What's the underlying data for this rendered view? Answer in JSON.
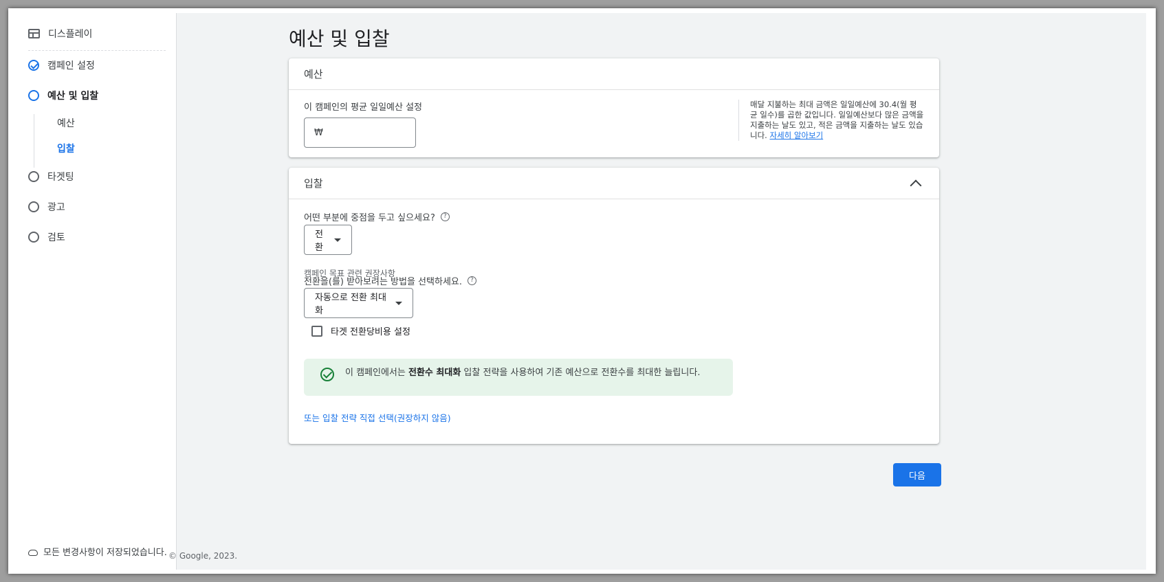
{
  "sidebar": {
    "items": [
      {
        "label": "디스플레이",
        "icon": "display-icon"
      },
      {
        "label": "캠페인 설정",
        "icon": "check-circle-icon"
      },
      {
        "label": "예산 및 입찰",
        "icon": "circle-icon"
      },
      {
        "label": "타겟팅",
        "icon": "circle-icon"
      },
      {
        "label": "광고",
        "icon": "circle-icon"
      },
      {
        "label": "검토",
        "icon": "circle-icon"
      }
    ],
    "sub_items": [
      {
        "label": "예산"
      },
      {
        "label": "입찰"
      }
    ],
    "saved_status": "모든 변경사항이 저장되었습니다."
  },
  "footer": {
    "copyright": "© Google, 2023."
  },
  "page": {
    "title": "예산 및 입찰"
  },
  "budget": {
    "header": "예산",
    "label": "이 캠페인의 평균 일일예산 설정",
    "currency_symbol": "₩",
    "help_text": "매달 지불하는 최대 금액은 일일예산에 30.4(월 평균 일수)를 곱한 값입니다. 일일예산보다 많은 금액을 지출하는 날도 있고, 적은 금액을 지출하는 날도 있습니다.",
    "help_link": "자세히 알아보기"
  },
  "bidding": {
    "header": "입찰",
    "focus_question": "어떤 부분에 중점을 두고 싶으세요?",
    "focus_value": "전환",
    "focus_hint": "캠페인 목표 관련 권장사항",
    "method_question": "전환을(를) 받아보려는 방법을 선택하세요.",
    "method_value": "자동으로 전환 최대화",
    "target_cpa_label": "타겟 전환당비용 설정",
    "target_cpa_checked": false,
    "info_prefix": "이 캠페인에서는 ",
    "info_bold": "전환수 최대화",
    "info_suffix": " 입찰 전략을 사용하여 기존 예산으로 전환수를 최대한 늘립니다.",
    "manual_link": "또는 입찰 전략 직접 선택(권장하지 않음)"
  },
  "actions": {
    "next": "다음"
  },
  "colors": {
    "accent": "#1a73e8",
    "success": "#188038",
    "info_bg": "#e6f4ea"
  }
}
